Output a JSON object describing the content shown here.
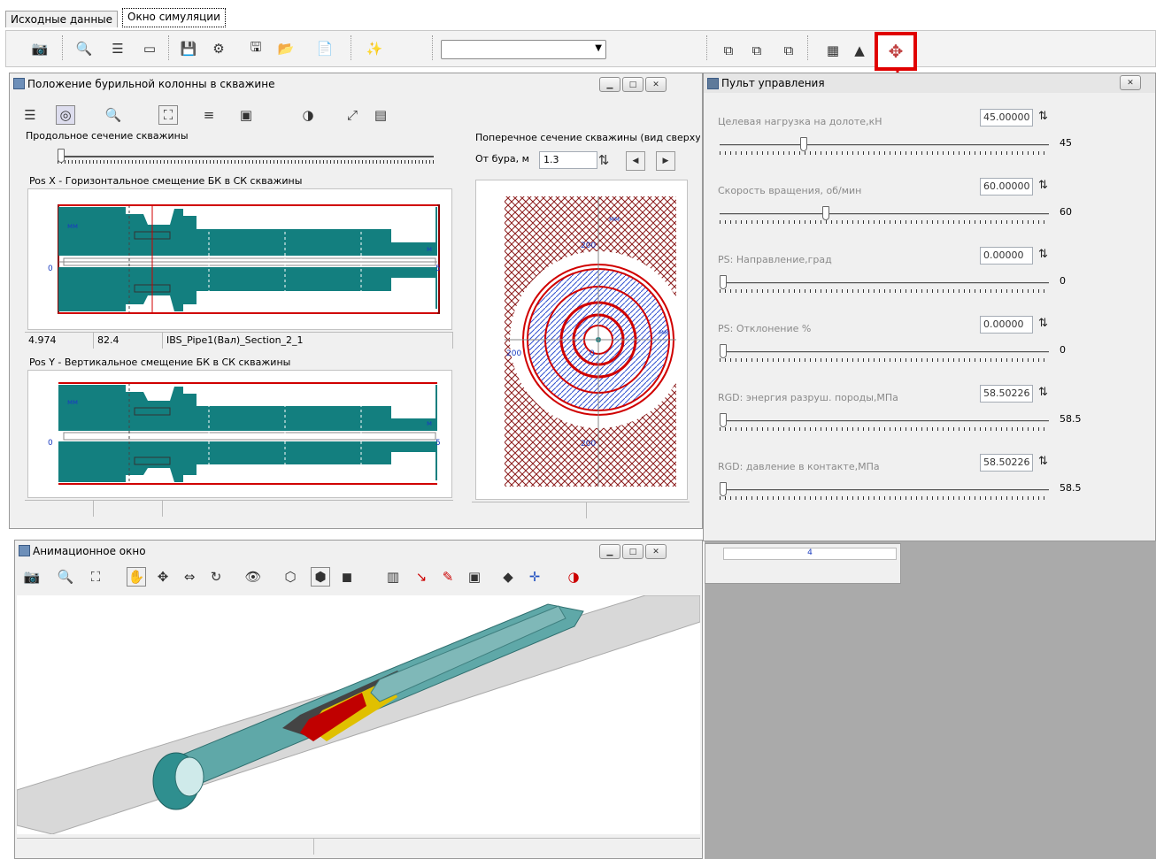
{
  "tabs": [
    {
      "label": "Исходные данные"
    },
    {
      "label": "Окно симуляции"
    }
  ],
  "toolbar": {
    "combo_value": "",
    "highlighted_icon": "control-panel-icon"
  },
  "drill_window": {
    "title": "Положение бурильной колонны в скважине",
    "long_section_label": "Продольное сечение скважины",
    "pos_x_label": "Pos X - Горизонтальное смещение БК в СК скважины",
    "pos_y_label": "Pos Y - Вертикальное смещение БК в СК скважины",
    "axis_unit_mm": "мм",
    "axis_unit_m": "м",
    "axis_zero": "0",
    "axis_end": "5",
    "status": {
      "c1": "4.974",
      "c2": "82.4",
      "c3": "IBS_Pipe1(Вал)_Section_2_1"
    },
    "cross_section_label": "Поперечное сечение скважины (вид сверху)",
    "from_drill_label": "От бура, м",
    "from_drill_value": "1.3",
    "cross_labels": {
      "top": "200",
      "bottom": "200",
      "left": "200",
      "center": "0",
      "unit": "мм"
    }
  },
  "control_panel": {
    "title": "Пульт управления",
    "controls": [
      {
        "label": "Целевая нагрузка на долоте,кН",
        "value": "45.00000",
        "display": "45",
        "level": 0.25
      },
      {
        "label": "Скорость вращения, об/мин",
        "value": "60.00000",
        "display": "60",
        "level": 0.32
      },
      {
        "label": "PS: Направление,град",
        "value": "0.00000",
        "display": "0",
        "level": 0.0
      },
      {
        "label": "PS: Отклонение %",
        "value": "0.00000",
        "display": "0",
        "level": 0.0
      },
      {
        "label": "RGD: энергия разруш. породы,МПа",
        "value": "58.50226",
        "display": "58.5",
        "level": 0.0
      },
      {
        "label": "RGD: давление в контакте,МПа",
        "value": "58.50226",
        "display": "58.5",
        "level": 0.0
      }
    ]
  },
  "background_cell": "4",
  "animation_window": {
    "title": "Анимационное окно"
  },
  "colors": {
    "teal": "#137f7f",
    "red": "#d00000",
    "highlight": "#e00000"
  }
}
